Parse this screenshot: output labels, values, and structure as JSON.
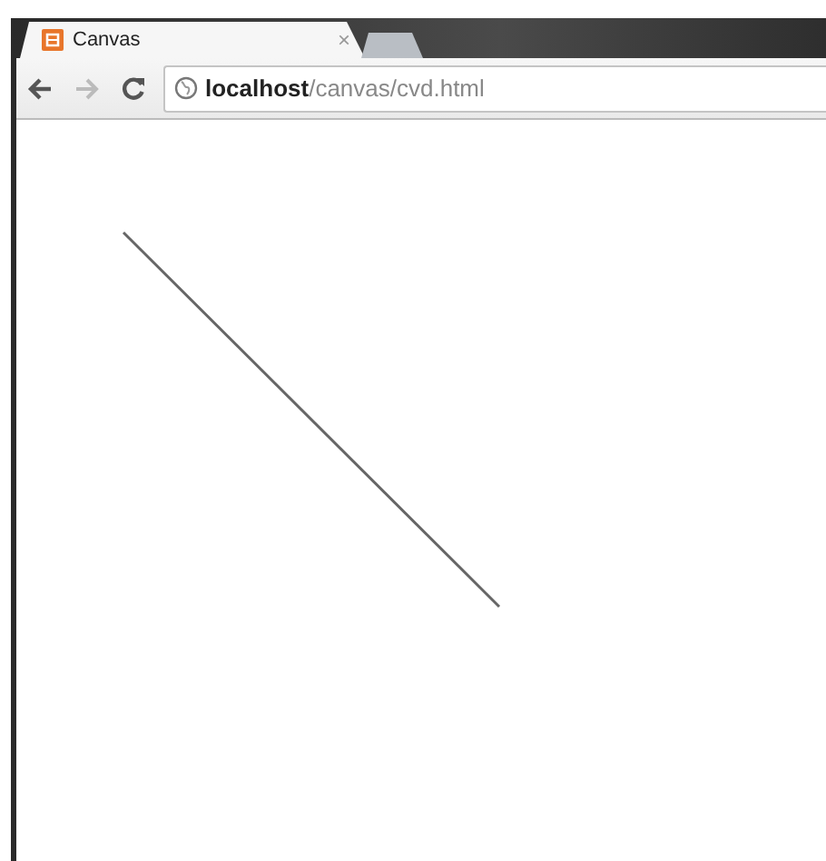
{
  "tabs": [
    {
      "title": "Canvas",
      "close": "×",
      "selected": true
    },
    {
      "selected": false
    }
  ],
  "address": "**localhost**/canvas/cvd.html"
}
